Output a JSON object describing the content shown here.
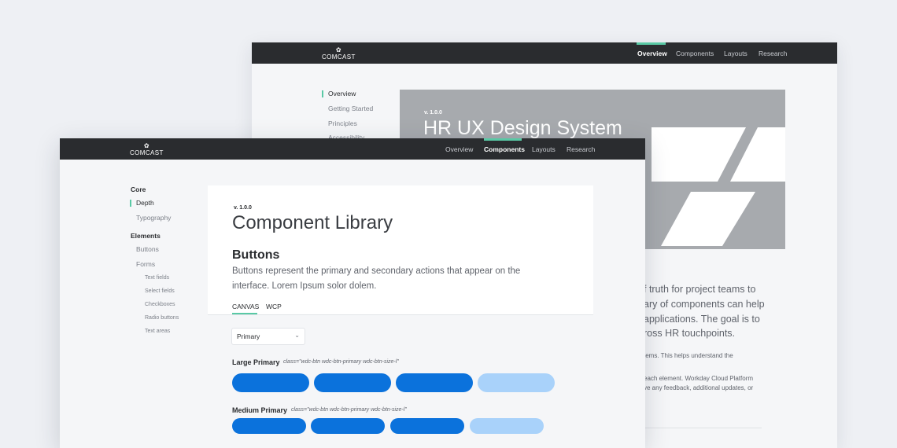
{
  "brand": "COMCAST",
  "back_window": {
    "nav": [
      "Overview",
      "Components",
      "Layouts",
      "Research"
    ],
    "active_nav": "Overview",
    "sidebar": [
      "Overview",
      "Getting Started",
      "Principles",
      "Accessibility"
    ],
    "version": "v. 1.0.0",
    "title": "HR UX Design System",
    "intro_lines": [
      "f truth for project teams to",
      "ary of components can help",
      " applications. The goal is to",
      "ross HR touchpoints."
    ],
    "detail_lines": [
      "tems. This helps understand the",
      "",
      " each element. Workday Cloud Platform",
      "ve any feedback, additional updates, or"
    ]
  },
  "front_window": {
    "nav": [
      "Overview",
      "Components",
      "Layouts",
      "Research"
    ],
    "active_nav": "Components",
    "sidebar": {
      "core_heading": "Core",
      "core_items": [
        "Depth",
        "Typography"
      ],
      "elements_heading": "Elements",
      "element_items": [
        "Buttons",
        "Forms"
      ],
      "form_items": [
        "Text fields",
        "Select fields",
        "Checkboxes",
        "Radio buttons",
        "Text areas"
      ]
    },
    "version": "v. 1.0.0",
    "title": "Component Library",
    "section_title": "Buttons",
    "section_desc_line1": "Buttons represent the primary and secondary actions that appear on the",
    "section_desc_line2": "interface. Lorem Ipsum solor dolem.",
    "tabs": [
      "CANVAS",
      "WCP"
    ],
    "active_tab": "CANVAS",
    "select_value": "Primary",
    "groups": [
      {
        "label": "Large Primary",
        "class_text": "class=\"wdc-btn wdc-btn-primary wdc-btn-size-l\""
      },
      {
        "label": "Medium Primary",
        "class_text": "class=\"wdc-btn wdc-btn-primary wdc-btn-size-l\""
      }
    ]
  },
  "colors": {
    "topbar": "#2a2c2f",
    "accent": "#59c9a5",
    "primary_button": "#0b72dc",
    "disabled_button": "#a9d2fa",
    "hero_gray": "#a7aaae"
  }
}
